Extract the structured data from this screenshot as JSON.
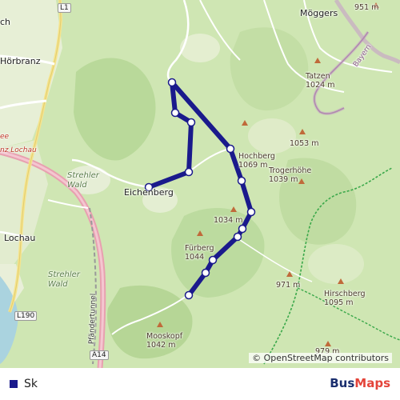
{
  "map": {
    "attribution": "© OpenStreetMap contributors",
    "colors": {
      "route": "#1a1a8c",
      "stop_fill": "#ffffff",
      "rail": "#e8a0b0",
      "border": "#9b6a9a",
      "forest_path": "#3aa84a"
    },
    "places": [
      {
        "id": "moggers",
        "text": "Möggers",
        "kind": "town"
      },
      {
        "id": "horbranz",
        "text": "Hörbranz",
        "kind": "town"
      },
      {
        "id": "ch",
        "text": "ch",
        "kind": "town"
      },
      {
        "id": "eichenberg",
        "text": "Eichenberg",
        "kind": "town"
      },
      {
        "id": "lochau",
        "text": "Lochau",
        "kind": "town"
      },
      {
        "id": "strehler-wald-1",
        "text": "Strehler\nWald",
        "kind": "forest"
      },
      {
        "id": "strehler-wald-2",
        "text": "Strehler\nWald",
        "kind": "forest"
      },
      {
        "id": "bayern",
        "text": "Bayern",
        "kind": "region"
      },
      {
        "id": "nz-lochau",
        "text": "nz Lochau",
        "kind": "green"
      },
      {
        "id": "pfandertunnel",
        "text": "Pfändertunnel",
        "kind": "tunnel"
      },
      {
        "id": "ee",
        "text": "ee",
        "kind": "green"
      }
    ],
    "roads": [
      {
        "id": "l1",
        "text": "L1"
      },
      {
        "id": "l190",
        "text": "L190"
      },
      {
        "id": "a14",
        "text": "A14"
      }
    ],
    "peaks": [
      {
        "id": "p951",
        "text": "951 m"
      },
      {
        "id": "tatzen",
        "text": "Tatzen\n1024 m"
      },
      {
        "id": "p1053",
        "text": "1053 m"
      },
      {
        "id": "hochberg",
        "text": "Hochberg\n1069 m"
      },
      {
        "id": "trogerhohe",
        "text": "Trogerhöhe\n1039 m"
      },
      {
        "id": "p1034",
        "text": "1034 m"
      },
      {
        "id": "furberg",
        "text": "Fürberg\n1044"
      },
      {
        "id": "p971",
        "text": "971 m"
      },
      {
        "id": "hirschberg",
        "text": "Hirschberg\n1095 m"
      },
      {
        "id": "mooskopf",
        "text": "Mooskopf\n1042 m"
      },
      {
        "id": "p979",
        "text": "979 m"
      }
    ],
    "stop_count": 11
  },
  "legend": {
    "route_label": "Sk"
  },
  "brand": {
    "part1": "Bus",
    "part2": "Maps"
  }
}
